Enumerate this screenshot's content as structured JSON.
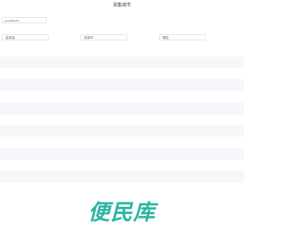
{
  "page": {
    "title": "货集城市"
  },
  "search": {
    "value": "",
    "placeholder": "yuandianzhi"
  },
  "filters": [
    {
      "label": "选择省"
    },
    {
      "label": "选择市"
    },
    {
      "label": "确定"
    }
  ],
  "list": {
    "rows": [
      "",
      "",
      "",
      "",
      "",
      "",
      "",
      "",
      "",
      "",
      "",
      "",
      ""
    ]
  },
  "watermark": {
    "text": "便民库",
    "color": "#2bb5a1"
  }
}
